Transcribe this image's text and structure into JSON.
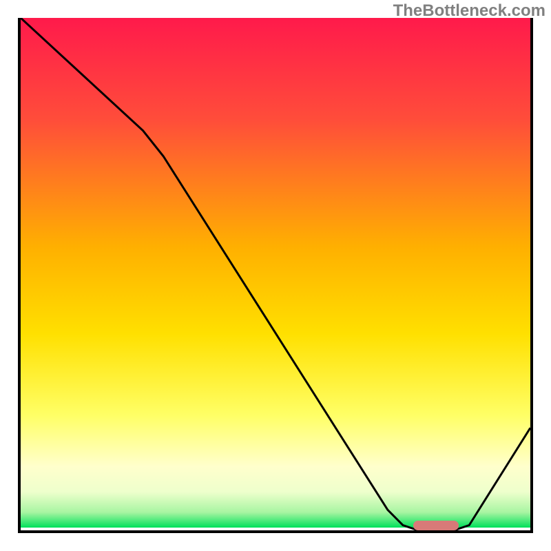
{
  "watermark_text": "TheBottleneck.com",
  "chart_data": {
    "type": "line",
    "title": "",
    "xlabel": "",
    "ylabel": "",
    "x_range": [
      0,
      100
    ],
    "y_range": [
      0,
      100
    ],
    "gradient_stops": [
      {
        "offset": 0,
        "color": "#ff1a4b"
      },
      {
        "offset": 20,
        "color": "#ff4d3a"
      },
      {
        "offset": 45,
        "color": "#ffb000"
      },
      {
        "offset": 62,
        "color": "#ffe000"
      },
      {
        "offset": 78,
        "color": "#ffff66"
      },
      {
        "offset": 88,
        "color": "#ffffcc"
      },
      {
        "offset": 93,
        "color": "#eeffcc"
      },
      {
        "offset": 97,
        "color": "#a8f5a2"
      },
      {
        "offset": 100,
        "color": "#00e05a"
      }
    ],
    "series": [
      {
        "name": "bottleneck-curve",
        "color": "#000000",
        "points": [
          {
            "x": 0,
            "y": 100
          },
          {
            "x": 24,
            "y": 78
          },
          {
            "x": 28,
            "y": 73
          },
          {
            "x": 72,
            "y": 4
          },
          {
            "x": 75,
            "y": 1
          },
          {
            "x": 78,
            "y": 0
          },
          {
            "x": 85,
            "y": 0
          },
          {
            "x": 88,
            "y": 1
          },
          {
            "x": 100,
            "y": 20
          }
        ]
      }
    ],
    "optimal_marker": {
      "x_start": 77,
      "x_end": 86,
      "y": 0,
      "color": "#d87a78"
    }
  }
}
